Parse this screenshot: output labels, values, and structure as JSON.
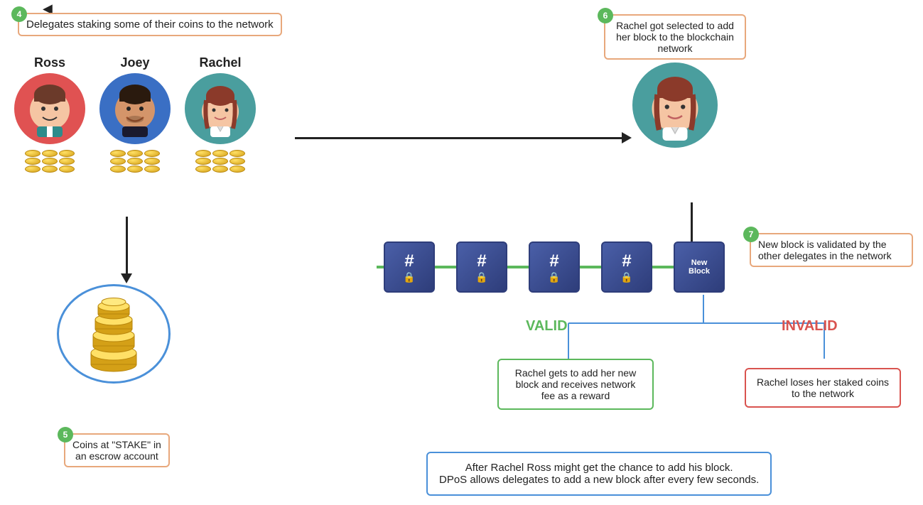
{
  "step4": {
    "badge": "4",
    "text": "Delegates staking some of their coins to the network"
  },
  "step5": {
    "badge": "5",
    "text": "Coins at \"STAKE\" in\nan escrow account"
  },
  "step6": {
    "badge": "6",
    "text": "Rachel got selected to add her block to the blockchain network"
  },
  "step7": {
    "badge": "7",
    "text": "New block is validated by the other delegates in the network"
  },
  "delegates": [
    {
      "name": "Ross",
      "avatarClass": "avatar-ross",
      "emoji": "😊"
    },
    {
      "name": "Joey",
      "avatarClass": "avatar-joey",
      "emoji": "😄"
    },
    {
      "name": "Rachel",
      "avatarClass": "avatar-rachel",
      "emoji": "🙂"
    }
  ],
  "valid": {
    "label": "VALID",
    "text": "Rachel gets to add her new block and receives network fee as a reward"
  },
  "invalid": {
    "label": "INVALID",
    "text": "Rachel loses her staked coins to the network"
  },
  "summary": {
    "text": "After Rachel Ross might get the chance to add his block.\nDPoS allows delegates to add a new block after every few seconds."
  },
  "blocks": [
    "#🔒",
    "#🔒",
    "#🔒",
    "#🔒"
  ],
  "newBlock": "New\nBlock"
}
